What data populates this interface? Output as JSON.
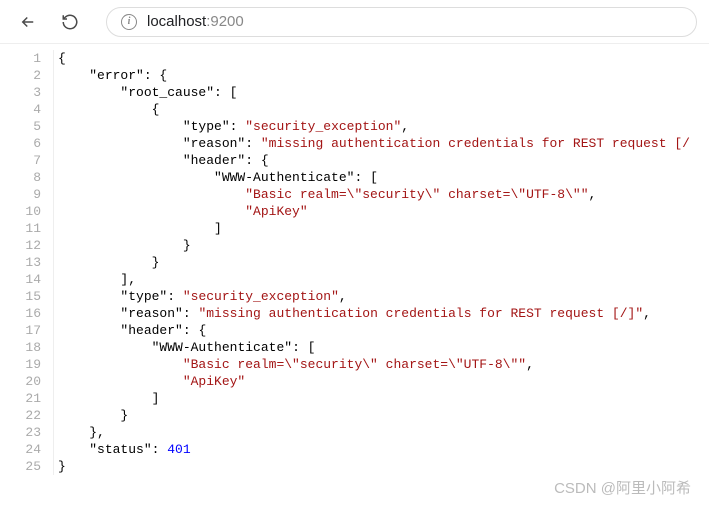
{
  "browser": {
    "url_host": "localhost",
    "url_port": ":9200"
  },
  "code": {
    "lines": [
      {
        "indent": 0,
        "parts": [
          {
            "t": "{",
            "c": "k-null"
          }
        ]
      },
      {
        "indent": 1,
        "parts": [
          {
            "t": "\"error\"",
            "c": "k-key"
          },
          {
            "t": ": {",
            "c": "k-null"
          }
        ]
      },
      {
        "indent": 2,
        "parts": [
          {
            "t": "\"root_cause\"",
            "c": "k-key"
          },
          {
            "t": ": [",
            "c": "k-null"
          }
        ]
      },
      {
        "indent": 3,
        "parts": [
          {
            "t": "{",
            "c": "k-null"
          }
        ]
      },
      {
        "indent": 4,
        "parts": [
          {
            "t": "\"type\"",
            "c": "k-key"
          },
          {
            "t": ": ",
            "c": "k-null"
          },
          {
            "t": "\"security_exception\"",
            "c": "k-str"
          },
          {
            "t": ",",
            "c": "k-null"
          }
        ]
      },
      {
        "indent": 4,
        "parts": [
          {
            "t": "\"reason\"",
            "c": "k-key"
          },
          {
            "t": ": ",
            "c": "k-null"
          },
          {
            "t": "\"missing authentication credentials for REST request [/",
            "c": "k-str"
          }
        ]
      },
      {
        "indent": 4,
        "parts": [
          {
            "t": "\"header\"",
            "c": "k-key"
          },
          {
            "t": ": {",
            "c": "k-null"
          }
        ]
      },
      {
        "indent": 5,
        "parts": [
          {
            "t": "\"WWW-Authenticate\"",
            "c": "k-key"
          },
          {
            "t": ": [",
            "c": "k-null"
          }
        ]
      },
      {
        "indent": 6,
        "parts": [
          {
            "t": "\"Basic realm=\\\"security\\\" charset=\\\"UTF-8\\\"\"",
            "c": "k-str"
          },
          {
            "t": ",",
            "c": "k-null"
          }
        ]
      },
      {
        "indent": 6,
        "parts": [
          {
            "t": "\"ApiKey\"",
            "c": "k-str"
          }
        ]
      },
      {
        "indent": 5,
        "parts": [
          {
            "t": "]",
            "c": "k-null"
          }
        ]
      },
      {
        "indent": 4,
        "parts": [
          {
            "t": "}",
            "c": "k-null"
          }
        ]
      },
      {
        "indent": 3,
        "parts": [
          {
            "t": "}",
            "c": "k-null"
          }
        ]
      },
      {
        "indent": 2,
        "parts": [
          {
            "t": "],",
            "c": "k-null"
          }
        ]
      },
      {
        "indent": 2,
        "parts": [
          {
            "t": "\"type\"",
            "c": "k-key"
          },
          {
            "t": ": ",
            "c": "k-null"
          },
          {
            "t": "\"security_exception\"",
            "c": "k-str"
          },
          {
            "t": ",",
            "c": "k-null"
          }
        ]
      },
      {
        "indent": 2,
        "parts": [
          {
            "t": "\"reason\"",
            "c": "k-key"
          },
          {
            "t": ": ",
            "c": "k-null"
          },
          {
            "t": "\"missing authentication credentials for REST request [/]\"",
            "c": "k-str"
          },
          {
            "t": ",",
            "c": "k-null"
          }
        ]
      },
      {
        "indent": 2,
        "parts": [
          {
            "t": "\"header\"",
            "c": "k-key"
          },
          {
            "t": ": {",
            "c": "k-null"
          }
        ]
      },
      {
        "indent": 3,
        "parts": [
          {
            "t": "\"WWW-Authenticate\"",
            "c": "k-key"
          },
          {
            "t": ": [",
            "c": "k-null"
          }
        ]
      },
      {
        "indent": 4,
        "parts": [
          {
            "t": "\"Basic realm=\\\"security\\\" charset=\\\"UTF-8\\\"\"",
            "c": "k-str"
          },
          {
            "t": ",",
            "c": "k-null"
          }
        ]
      },
      {
        "indent": 4,
        "parts": [
          {
            "t": "\"ApiKey\"",
            "c": "k-str"
          }
        ]
      },
      {
        "indent": 3,
        "parts": [
          {
            "t": "]",
            "c": "k-null"
          }
        ]
      },
      {
        "indent": 2,
        "parts": [
          {
            "t": "}",
            "c": "k-null"
          }
        ]
      },
      {
        "indent": 1,
        "parts": [
          {
            "t": "},",
            "c": "k-null"
          }
        ]
      },
      {
        "indent": 1,
        "parts": [
          {
            "t": "\"status\"",
            "c": "k-key"
          },
          {
            "t": ": ",
            "c": "k-null"
          },
          {
            "t": "401",
            "c": "k-num"
          }
        ]
      },
      {
        "indent": 0,
        "parts": [
          {
            "t": "}",
            "c": "k-null"
          }
        ]
      }
    ],
    "indent_unit": "    "
  },
  "watermark": "CSDN @阿里小阿希"
}
